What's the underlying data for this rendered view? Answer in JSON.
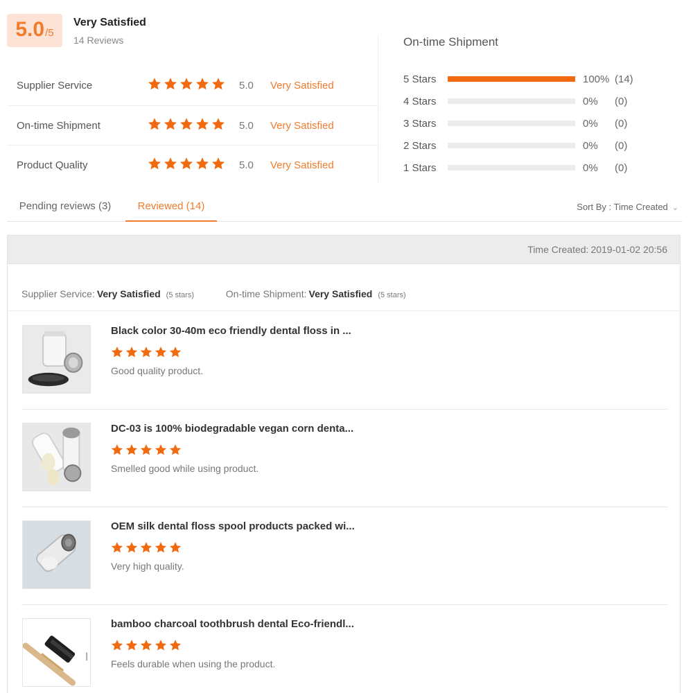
{
  "summary": {
    "score": "5.0",
    "score_max": "/5",
    "label": "Very Satisfied",
    "review_count": "14 Reviews"
  },
  "ratings": [
    {
      "label": "Supplier Service",
      "stars": 5,
      "value": "5.0",
      "text": "Very Satisfied"
    },
    {
      "label": "On-time Shipment",
      "stars": 5,
      "value": "5.0",
      "text": "Very Satisfied"
    },
    {
      "label": "Product Quality",
      "stars": 5,
      "value": "5.0",
      "text": "Very Satisfied"
    }
  ],
  "distribution": {
    "title": "On-time Shipment",
    "rows": [
      {
        "label": "5 Stars",
        "fraction": 1.0,
        "percent": "100%",
        "count": "(14)"
      },
      {
        "label": "4 Stars",
        "fraction": 0.0,
        "percent": "0%",
        "count": "(0)"
      },
      {
        "label": "3 Stars",
        "fraction": 0.0,
        "percent": "0%",
        "count": "(0)"
      },
      {
        "label": "2 Stars",
        "fraction": 0.0,
        "percent": "0%",
        "count": "(0)"
      },
      {
        "label": "1 Stars",
        "fraction": 0.0,
        "percent": "0%",
        "count": "(0)"
      }
    ]
  },
  "tabs": {
    "pending": "Pending reviews (3)",
    "reviewed": "Reviewed (14)",
    "active": "reviewed"
  },
  "sort": {
    "label": "Sort By : Time Created",
    "icon": "chevron-down-icon"
  },
  "review": {
    "time_label": "Time Created:",
    "time_value": "2019-01-02 20:56",
    "supplier_label": "Supplier Service:",
    "supplier_value": "Very Satisfied",
    "supplier_stars": "(5 stars)",
    "shipment_label": "On-time Shipment:",
    "shipment_value": "Very Satisfied",
    "shipment_stars": "(5 stars)",
    "items": [
      {
        "title": "Black color 30-40m eco friendly dental floss in ...",
        "stars": 5,
        "comment": "Good quality product.",
        "thumb": "floss-jar"
      },
      {
        "title": "DC-03 is 100% biodegradable vegan corn denta...",
        "stars": 5,
        "comment": "Smelled good while using product.",
        "thumb": "floss-spools"
      },
      {
        "title": "OEM silk dental floss spool products packed wi...",
        "stars": 5,
        "comment": "Very high quality.",
        "thumb": "floss-spool-single"
      },
      {
        "title": "bamboo charcoal toothbrush dental Eco-friendl...",
        "stars": 5,
        "comment": "Feels durable when using the product.",
        "thumb": "toothbrush"
      }
    ]
  },
  "colors": {
    "accent": "#f27b2c",
    "star": "#f26a10",
    "score_bg": "#fde3d6"
  }
}
